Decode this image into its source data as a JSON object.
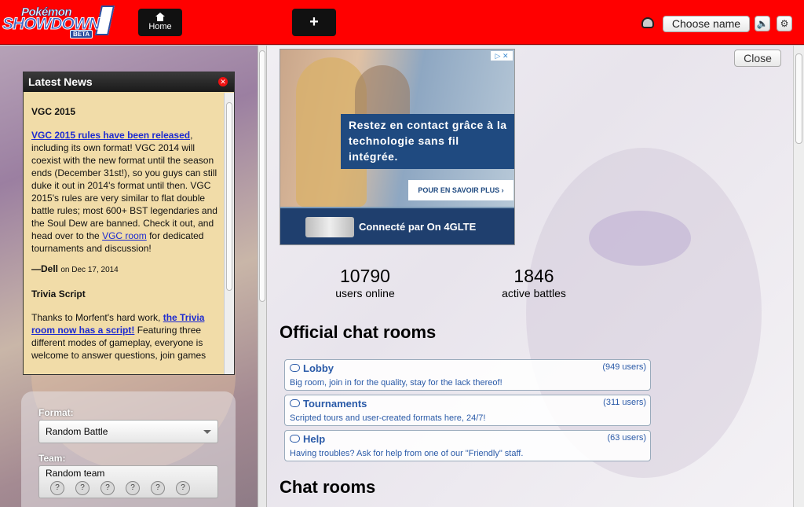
{
  "header": {
    "logo_top": "Pokémon",
    "logo_main": "SHOWDOWN",
    "logo_badge": "BETA",
    "home_tab_label": "Home",
    "add_tab_label": "+",
    "choose_name_label": "Choose name",
    "sound_icon": "volume-icon",
    "options_icon": "gear-icon"
  },
  "news": {
    "title": "Latest News",
    "items": [
      {
        "heading": "VGC 2015",
        "link": "VGC 2015 rules have been released",
        "text1": ", including its own format! VGC 2014 will coexist with the new format until the season ends (December 31st!), so you guys can still duke it out in 2014's format until then. VGC 2015's rules are very similar to flat double battle rules; most 600+ BST legendaries and the Soul Dew are banned. Check it out, and head over to the ",
        "link2": "VGC room",
        "text2": " for dedicated tournaments and discussion!",
        "author": "—Dell",
        "date": "on Dec 17, 2014"
      },
      {
        "heading": "Trivia Script",
        "text1": "Thanks to Morfent's hard work, ",
        "link": "the Trivia room now has a script!",
        "text2": " Featuring three different modes of gameplay, everyone is welcome to answer questions, join games"
      }
    ]
  },
  "battle_form": {
    "format_label": "Format:",
    "format_value": "Random Battle",
    "team_label": "Team:",
    "team_value": "Random team"
  },
  "ad": {
    "message": "Restez en contact grâce à la technologie sans fil intégrée.",
    "cta": "POUR EN SAVOIR PLUS ›",
    "tagline": "Connecté par On 4GLTE",
    "adchoices": "▷ ✕"
  },
  "main": {
    "close_label": "Close",
    "users_count": "10790",
    "users_label": "users online",
    "battles_count": "1846",
    "battles_label": "active battles",
    "official_title": "Official chat rooms",
    "chat_title": "Chat rooms",
    "rooms": [
      {
        "name": "Lobby",
        "count": "(949 users)",
        "desc": "Big room, join in for the quality, stay for the lack thereof!"
      },
      {
        "name": "Tournaments",
        "count": "(311 users)",
        "desc": "Scripted tours and user-created formats here, 24/7!"
      },
      {
        "name": "Help",
        "count": "(63 users)",
        "desc": "Having troubles? Ask for help from one of our \"Friendly\" staff."
      }
    ]
  }
}
